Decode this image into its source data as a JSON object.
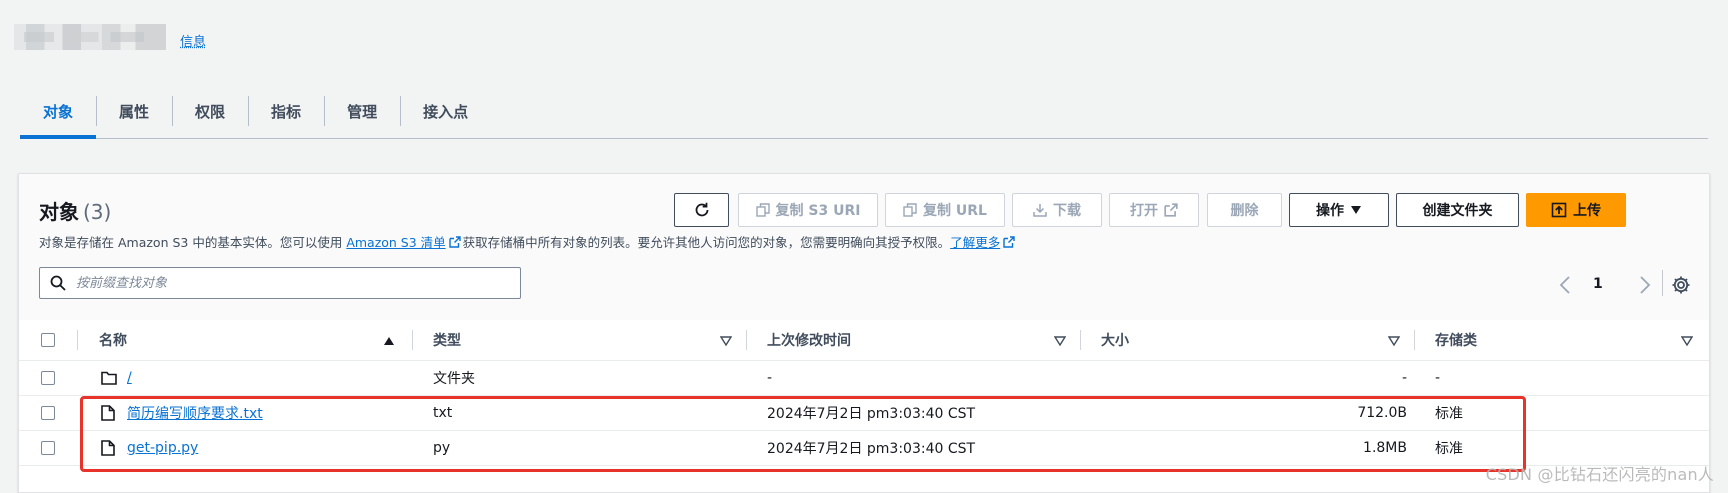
{
  "header": {
    "info_link": "信息"
  },
  "tabs": [
    "对象",
    "属性",
    "权限",
    "指标",
    "管理",
    "接入点"
  ],
  "objects": {
    "title": "对象",
    "count": "(3)",
    "desc_prefix": "对象是存储在 Amazon S3 中的基本实体。您可以使用",
    "desc_link": "Amazon S3 清单",
    "desc_middle": "获取存储桶中所有对象的列表。要允许其他人访问您的对象，您需要明确向其授予权限。",
    "desc_learn": "了解更多"
  },
  "toolbar": {
    "copy_s3_uri": "复制 S3 URI",
    "copy_url": "复制 URL",
    "download": "下载",
    "open": "打开",
    "delete": "删除",
    "actions": "操作",
    "create_folder": "创建文件夹",
    "upload": "上传"
  },
  "search": {
    "placeholder": "按前缀查找对象"
  },
  "pagination": {
    "page": "1"
  },
  "table": {
    "headers": {
      "name": "名称",
      "type": "类型",
      "modified": "上次修改时间",
      "size": "大小",
      "storage": "存储类"
    },
    "rows": [
      {
        "name": "/",
        "type": "文件夹",
        "modified": "-",
        "size": "-",
        "storage": "-",
        "icon": "folder-icon"
      },
      {
        "name": "简历编写顺序要求.txt",
        "type": "txt",
        "modified": "2024年7月2日 pm3:03:40 CST",
        "size": "712.0B",
        "storage": "标准",
        "icon": "file-icon"
      },
      {
        "name": "get-pip.py",
        "type": "py",
        "modified": "2024年7月2日 pm3:03:40 CST",
        "size": "1.8MB",
        "storage": "标准",
        "icon": "file-icon"
      }
    ]
  },
  "watermark": "CSDN @比钻石还闪亮的nan人",
  "colors": {
    "accent": "#0972d3",
    "primary": "#ff9900",
    "highlight": "#e8332a"
  }
}
